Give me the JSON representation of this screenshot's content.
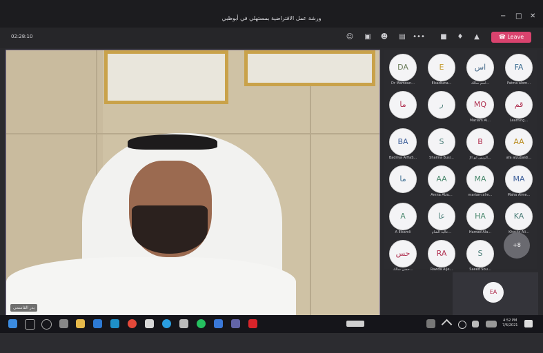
{
  "window": {
    "title": "ورشة عمل الاقتراضية بمستهلي في أبوظبي",
    "minimize": "−",
    "maximize": "□",
    "close": "✕"
  },
  "toolbar": {
    "timer": "02:28:10",
    "leave_label": "Leave",
    "more_label": "•••",
    "accent": "#d9436e"
  },
  "video": {
    "speaker_name": "بدر القاسمي"
  },
  "gallery": [
    {
      "initials": "DA",
      "name": "Dr Mamoun...",
      "color": "#6b7d5a"
    },
    {
      "initials": "E",
      "name": "Elsadiuna...",
      "color": "#c59a2d"
    },
    {
      "initials": "اس",
      "name": "اسم سالك...",
      "color": "#4c6f8e"
    },
    {
      "initials": "FA",
      "name": "Fatma alom...",
      "color": "#3d6e92"
    },
    {
      "initials": "ما",
      "name": "",
      "color": "#b03050"
    },
    {
      "initials": "ر",
      "name": "",
      "color": "#4d7f7a"
    },
    {
      "initials": "MQ",
      "name": "Mariam Al...",
      "color": "#b03050"
    },
    {
      "initials": "قم",
      "name": "Learning...",
      "color": "#b03050"
    },
    {
      "initials": "BA",
      "name": "Badriya AlHaS...",
      "color": "#3d5f9a"
    },
    {
      "initials": "S",
      "name": "Shaima Busi...",
      "color": "#4d7f7a"
    },
    {
      "initials": "B",
      "name": "الريس ابو الإ...",
      "color": "#b03050"
    },
    {
      "initials": "AA",
      "name": "afa alzubaidi...",
      "color": "#b98b1e"
    },
    {
      "initials": "ما",
      "name": "",
      "color": "#3d6e92"
    },
    {
      "initials": "AA",
      "name": "Amna Alzu...",
      "color": "#4d8a6f"
    },
    {
      "initials": "MA",
      "name": "mariam alm...",
      "color": "#4d8a6f"
    },
    {
      "initials": "MA",
      "name": "Maha Alme...",
      "color": "#3d5f9a"
    },
    {
      "initials": "A",
      "name": "A Elsamli",
      "color": "#4d8a6f"
    },
    {
      "initials": "عا",
      "name": "عالية الشام...",
      "color": "#4d7f7a"
    },
    {
      "initials": "HA",
      "name": "Hamad Ala...",
      "color": "#4d8a6f"
    },
    {
      "initials": "KA",
      "name": "Khaula Ali...",
      "color": "#4d7f7a"
    },
    {
      "initials": "حس",
      "name": "حسن سالك...",
      "color": "#b03050"
    },
    {
      "initials": "RA",
      "name": "Rawda Alje...",
      "color": "#b03050"
    },
    {
      "initials": "S",
      "name": "Saeed Sbu...",
      "color": "#4d7f7a"
    }
  ],
  "more_count": "+8",
  "self": {
    "initials": "EA"
  },
  "taskbar": {
    "time": "4:52 PM",
    "date": "7/6/2021"
  }
}
